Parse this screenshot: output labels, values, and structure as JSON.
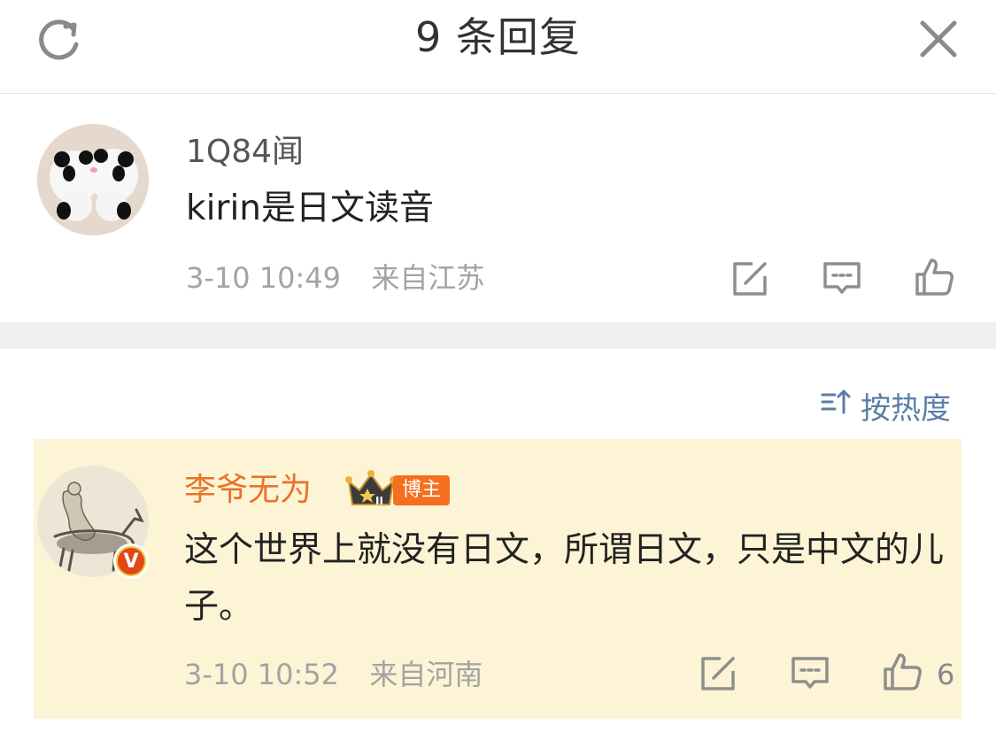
{
  "header": {
    "title": "9 条回复",
    "refresh_icon": "refresh-icon",
    "close_icon": "close-icon"
  },
  "root_reply": {
    "username": "1Q84闻",
    "content": "kirin是日文读音",
    "time": "3-10 10:49",
    "location": "来自江苏",
    "actions": [
      "share-icon",
      "comment-icon",
      "like-icon"
    ]
  },
  "sort": {
    "label": "按热度",
    "icon": "sort-icon"
  },
  "author_reply": {
    "username": "李爷无为",
    "badge": "博主",
    "verified": "V",
    "content": "这个世界上就没有日文，所谓日文，只是中文的儿子。",
    "time": "3-10 10:52",
    "location": "来自河南",
    "like_count": "6",
    "actions": [
      "share-icon",
      "comment-icon",
      "like-icon"
    ]
  },
  "colors": {
    "accent_orange": "#e8742a",
    "link_blue": "#5b7ea6",
    "highlight_bg": "#fdf4d6",
    "meta_gray": "#a3a3a3"
  }
}
